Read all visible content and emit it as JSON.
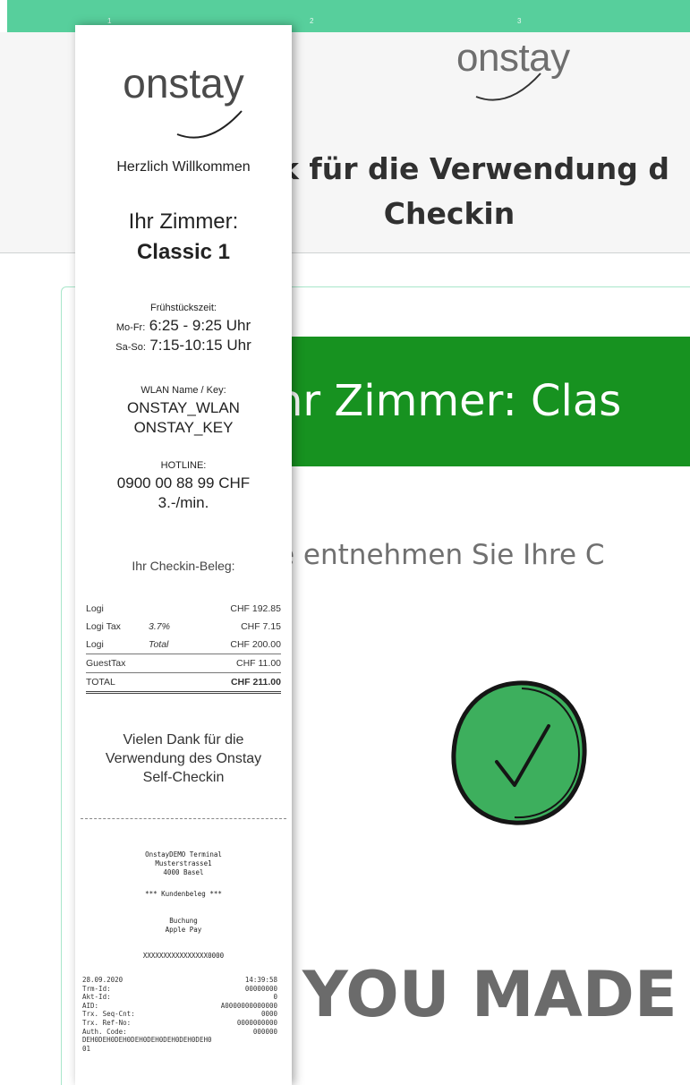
{
  "steps": [
    "1",
    "2",
    "3"
  ],
  "brand": {
    "name": "onstay"
  },
  "header": {
    "line1": "k für die Verwendung d",
    "line2": "Checkin"
  },
  "banner": {
    "text": "hr Zimmer: Clas"
  },
  "instruction": "e entnehmen Sie Ihre C",
  "made": "YOU MADE",
  "colors": {
    "topbar": "#57cf9c",
    "banner": "#179220",
    "check_fill": "#3daf5d"
  },
  "icons": {
    "check": "check-circle-icon",
    "brand_swoosh": "swoosh-logo-icon"
  },
  "receipt": {
    "welcome": "Herzlich Willkommen",
    "room_label": "Ihr Zimmer:",
    "room": "Classic 1",
    "breakfast_label": "Frühstückszeit:",
    "weekday_prefix": "Mo-Fr:",
    "weekday_time": "6:25 - 9:25 Uhr",
    "weekend_prefix": "Sa-So:",
    "weekend_time": "7:15-10:15 Uhr",
    "wlan_label": "WLAN Name / Key:",
    "wlan_name": "ONSTAY_WLAN",
    "wlan_key": "ONSTAY_KEY",
    "hotline_label": "HOTLINE:",
    "hotline_number": "0900 00 88 99 CHF",
    "hotline_rate": "3.-/min.",
    "beleg_title": "Ihr Checkin-Beleg:",
    "rows": [
      {
        "label": "Logi",
        "note": "",
        "value": "CHF 192.85"
      },
      {
        "label": "Logi Tax",
        "note": "3.7%",
        "value": "CHF 7.15"
      },
      {
        "label": "Logi",
        "note": "Total",
        "value": "CHF 200.00"
      },
      {
        "label": "GuestTax",
        "note": "",
        "value": "CHF 11.00"
      },
      {
        "label": "TOTAL",
        "note": "",
        "value": "CHF 211.00"
      }
    ],
    "thanks1": "Vielen Dank für die",
    "thanks2": "Verwendung des Onstay",
    "thanks3": "Self-Checkin",
    "terminal1": "OnstayDEMO Terminal",
    "terminal2": "Musterstrasse1",
    "terminal3": "4000 Basel",
    "kundenbeleg": "*** Kundenbeleg ***",
    "buchung": "Buchung",
    "payment": "Apple Pay",
    "card_number": "XXXXXXXXXXXXXXXX0000",
    "tx": [
      {
        "k": "28.09.2020",
        "v": "14:39:58"
      },
      {
        "k": "Trm-Id:",
        "v": "00000000"
      },
      {
        "k": "Akt-Id:",
        "v": "0"
      },
      {
        "k": "AID:",
        "v": "A0000000000000"
      },
      {
        "k": "Trx. Seq-Cnt:",
        "v": "0000"
      },
      {
        "k": "Trx. Ref-No:",
        "v": "0000000000"
      },
      {
        "k": "Auth. Code:",
        "v": "000000"
      }
    ],
    "hash": "DEH0DEH0DEH0DEH0DEH0DEH0DEH0DEH0",
    "hash_tail": "01"
  }
}
